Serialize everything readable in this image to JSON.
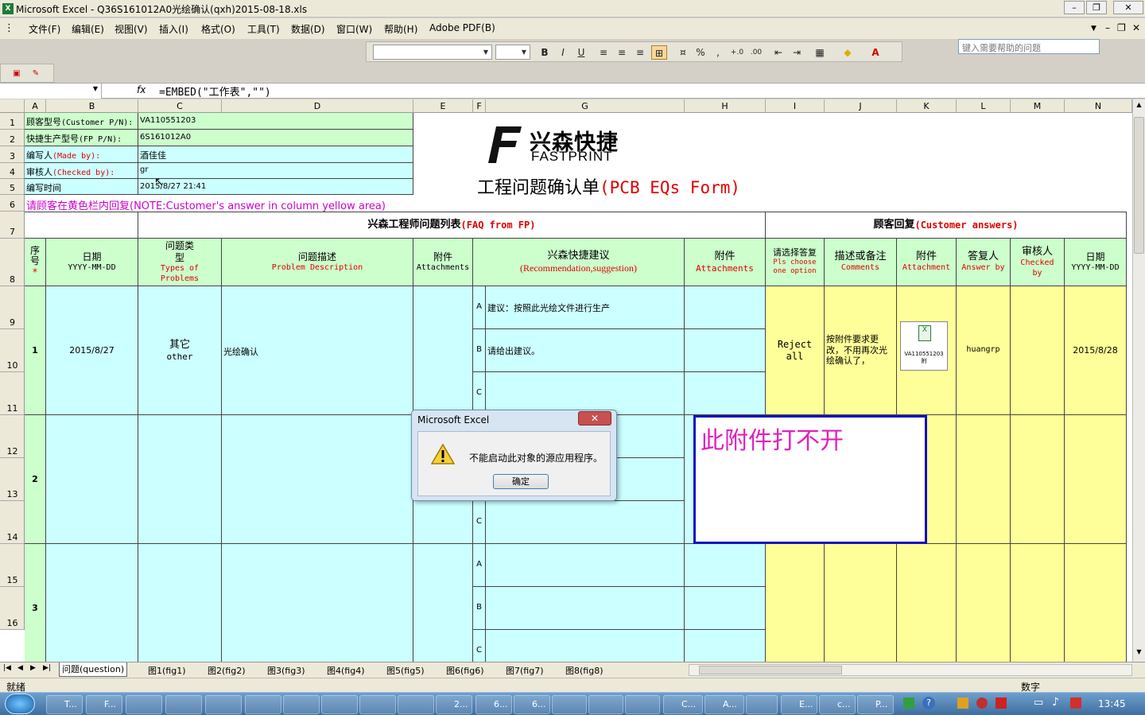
{
  "window": {
    "title": "Microsoft Excel - Q36S161012A0光绘确认(qxh)2015-08-18.xls",
    "icon_label": "X"
  },
  "menu": [
    "文件(F)",
    "编辑(E)",
    "视图(V)",
    "插入(I)",
    "格式(O)",
    "工具(T)",
    "数据(D)",
    "窗口(W)",
    "帮助(H)",
    "Adobe PDF(B)"
  ],
  "help_placeholder": "键入需要帮助的问题",
  "formula": {
    "fx": "fx",
    "text": "=EMBED(\"工作表\",\"\")"
  },
  "columns": [
    "A",
    "B",
    "C",
    "D",
    "E",
    "F",
    "G",
    "H",
    "I",
    "J",
    "K",
    "L",
    "M",
    "N"
  ],
  "rows": [
    "1",
    "2",
    "3",
    "4",
    "5",
    "6",
    "7",
    "8",
    "9",
    "10",
    "11",
    "12",
    "13",
    "14",
    "15",
    "16"
  ],
  "info": {
    "customer_pn_label": "顾客型号",
    "customer_pn_en": "(Customer P/N):",
    "customer_pn": "VA110551203",
    "fp_pn_label": "快捷生产型号",
    "fp_pn_en": "(FP P/N):",
    "fp_pn": "6S161012A0",
    "made_by_label": "编写人",
    "made_by_en": "(Made by):",
    "made_by": "酒佳佳",
    "checked_by_label": "审核人",
    "checked_by_en": "(Checked by):",
    "checked_by": "gr",
    "time_label": "编写时间",
    "time": "2015/8/27 21:41"
  },
  "logo": {
    "cn": "兴森快捷",
    "en": "FASTPRINT"
  },
  "form_title_cn": "工程问题确认单",
  "form_title_en": "(PCB EQs Form)",
  "note": "请顾客在黄色栏内回复(NOTE:Customer's answer in column yellow area)",
  "faq_header_cn": "兴森工程师问题列表",
  "faq_header_en": "(FAQ from FP)",
  "cust_header_cn": "顾客回复",
  "cust_header_en": "(Customer answers)",
  "headers": {
    "seq": "序号",
    "star": "*",
    "date_cn": "日期",
    "date_en": "YYYY-MM-DD",
    "type_cn": "问题类型",
    "type_en": "Types of Problems",
    "desc_cn": "问题描述",
    "desc_en": "Problem Description",
    "att_cn": "附件",
    "att_en": "Attachments",
    "sugg_cn": "兴森快捷建议",
    "sugg_en": "(Recommendation,suggestion)",
    "att2_cn": "附件",
    "att2_en": "Attachments",
    "choose_cn": "请选择答复",
    "choose_en": "Pls choose one option",
    "comments_cn": "描述或备注",
    "comments_en": "Comments",
    "attach_cn": "附件",
    "attach_en": "Attachment",
    "answer_cn": "答复人",
    "answer_en": "Answer by",
    "checked_cn": "审核人",
    "checked_en": "Checked by",
    "cdate_cn": "日期",
    "cdate_en": "YYYY-MM-DD"
  },
  "items": [
    {
      "no": "1",
      "date": "2015/8/27",
      "type_cn": "其它",
      "type_en": "other",
      "desc": "光绘确认",
      "options": [
        {
          "k": "A",
          "t": "建议：按照此光绘文件进行生产"
        },
        {
          "k": "B",
          "t": "请给出建议。"
        },
        {
          "k": "C",
          "t": ""
        }
      ],
      "reply": "Reject all",
      "comments": "按附件要求更改，不用再次光绘确认了，",
      "attach_name": "VA110551203 附",
      "answer_by": "huangrp",
      "checked_by": "",
      "reply_date": "2015/8/28"
    },
    {
      "no": "2",
      "options": [
        {
          "k": "A",
          "t": ""
        },
        {
          "k": "B",
          "t": ""
        },
        {
          "k": "C",
          "t": ""
        }
      ]
    },
    {
      "no": "3",
      "options": [
        {
          "k": "A",
          "t": ""
        },
        {
          "k": "B",
          "t": ""
        },
        {
          "k": "C",
          "t": ""
        }
      ]
    }
  ],
  "annotation": "此附件打不开",
  "dialog": {
    "title": "Microsoft Excel",
    "message": "不能启动此对象的源应用程序。",
    "ok": "确定"
  },
  "tabs": [
    "问题(question)",
    "图1(fig1)",
    "图2(fig2)",
    "图3(fig3)",
    "图4(fig4)",
    "图5(fig5)",
    "图6(fig6)",
    "图7(fig7)",
    "图8(fig8)"
  ],
  "status": {
    "ready": "就绪",
    "num": "数字"
  },
  "taskbar": {
    "clock": "13:45",
    "apps": [
      "T...",
      "F...",
      "",
      "",
      "",
      "",
      "",
      "",
      "",
      "",
      "2...",
      "6...",
      "6...",
      "",
      "",
      "",
      "C...",
      "A...",
      "",
      "E...",
      "c...",
      "P..."
    ]
  }
}
